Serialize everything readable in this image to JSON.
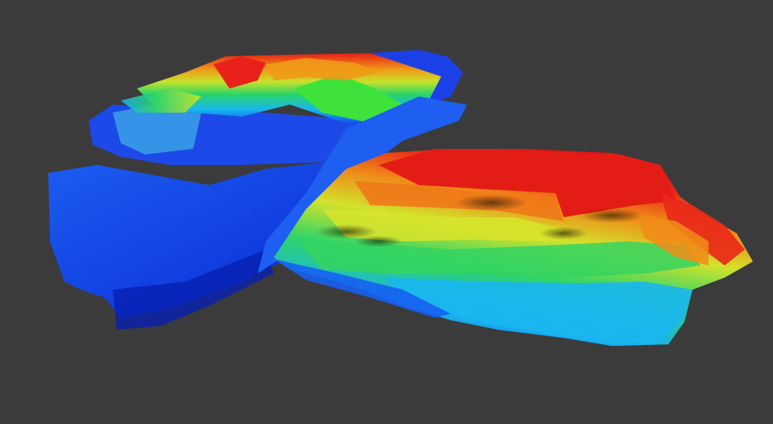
{
  "viewer": {
    "background_color": "#3b3b3b",
    "colormap": [
      "#0a1ee0",
      "#1aa6f0",
      "#2bd66a",
      "#c9e52a",
      "#f0a01a",
      "#e8221a"
    ],
    "scene": "3d-elevation-terrain-render"
  }
}
